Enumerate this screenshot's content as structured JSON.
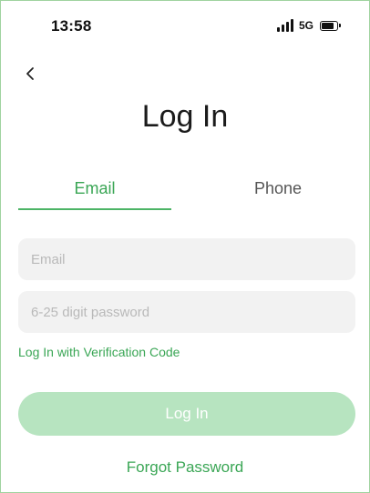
{
  "status_bar": {
    "time": "13:58",
    "network": "5G",
    "icons": [
      "signal-icon",
      "battery-icon"
    ]
  },
  "header": {
    "back_icon": "chevron-left-icon",
    "title": "Log In"
  },
  "tabs": [
    {
      "label": "Email",
      "active": true
    },
    {
      "label": "Phone",
      "active": false
    }
  ],
  "form": {
    "email_placeholder": "Email",
    "password_placeholder": "6-25 digit password",
    "verification_link": "Log In with Verification Code",
    "submit_label": "Log In",
    "forgot_label": "Forgot Password"
  },
  "colors": {
    "accent": "#3aa655",
    "button_disabled": "#b7e4c0",
    "field_bg": "#f2f2f2",
    "border": "#9fd39f"
  }
}
